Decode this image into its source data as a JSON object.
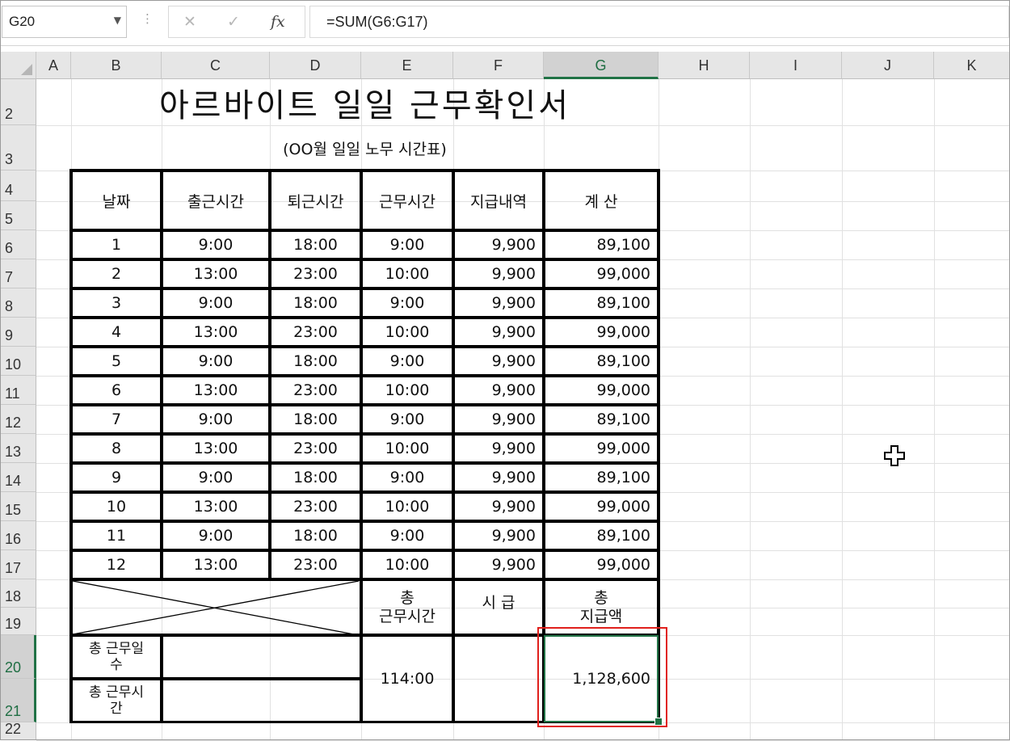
{
  "formula_bar": {
    "name_box": "G20",
    "formula": "=SUM(G6:G17)",
    "fx_label": "fx",
    "cancel_icon": "✕",
    "enter_icon": "✓"
  },
  "columns": [
    "A",
    "B",
    "C",
    "D",
    "E",
    "F",
    "G",
    "H",
    "I",
    "J",
    "K"
  ],
  "rows": [
    "2",
    "3",
    "4",
    "5",
    "6",
    "7",
    "8",
    "9",
    "10",
    "11",
    "12",
    "13",
    "14",
    "15",
    "16",
    "17",
    "18",
    "19",
    "20",
    "21",
    "22"
  ],
  "selected": {
    "column": "G",
    "rows": [
      "20",
      "21"
    ]
  },
  "sheet": {
    "title": "아르바이트 일일 근무확인서",
    "subtitle": "(OO월 일일 노무 시간표)",
    "headers": [
      "날짜",
      "출근시간",
      "퇴근시간",
      "근무시간",
      "지급내역",
      "계  산"
    ],
    "data_rows": [
      [
        "1",
        "9:00",
        "18:00",
        "9:00",
        "9,900",
        "89,100"
      ],
      [
        "2",
        "13:00",
        "23:00",
        "10:00",
        "9,900",
        "99,000"
      ],
      [
        "3",
        "9:00",
        "18:00",
        "9:00",
        "9,900",
        "89,100"
      ],
      [
        "4",
        "13:00",
        "23:00",
        "10:00",
        "9,900",
        "99,000"
      ],
      [
        "5",
        "9:00",
        "18:00",
        "9:00",
        "9,900",
        "89,100"
      ],
      [
        "6",
        "13:00",
        "23:00",
        "10:00",
        "9,900",
        "99,000"
      ],
      [
        "7",
        "9:00",
        "18:00",
        "9:00",
        "9,900",
        "89,100"
      ],
      [
        "8",
        "13:00",
        "23:00",
        "10:00",
        "9,900",
        "99,000"
      ],
      [
        "9",
        "9:00",
        "18:00",
        "9:00",
        "9,900",
        "89,100"
      ],
      [
        "10",
        "13:00",
        "23:00",
        "10:00",
        "9,900",
        "99,000"
      ],
      [
        "11",
        "9:00",
        "18:00",
        "9:00",
        "9,900",
        "89,100"
      ],
      [
        "12",
        "13:00",
        "23:00",
        "10:00",
        "9,900",
        "99,000"
      ]
    ],
    "summary": {
      "total_hours_label_1": "총",
      "total_hours_label_2": "근무시간",
      "wage_label": "시  급",
      "total_pay_label_1": "총",
      "total_pay_label_2": "지급액",
      "total_days_label_1": "총 근무일",
      "total_days_label_2": "수",
      "total_work_label_1": "총 근무시",
      "total_work_label_2": "간",
      "total_hours_value": "114:00",
      "total_pay_value": "1,128,600"
    }
  },
  "colors": {
    "selection": "#217346",
    "highlight": "#e0201c"
  },
  "cursor_icon": "cell-select-cross-icon"
}
